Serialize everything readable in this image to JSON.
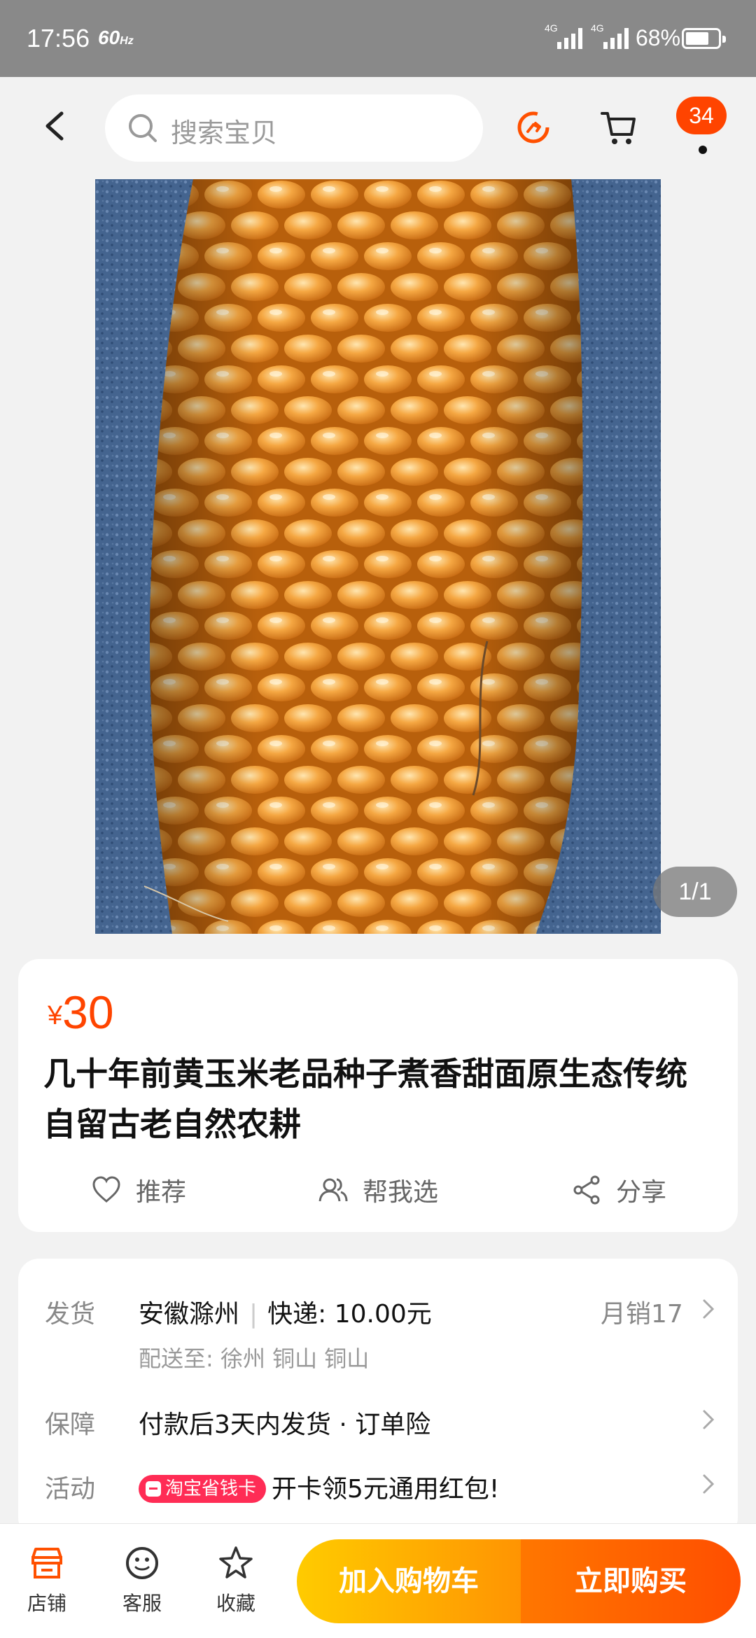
{
  "status_bar": {
    "time": "17:56",
    "refresh_rate": "60",
    "refresh_unit": "Hz",
    "network_1": "4G",
    "network_2": "4G",
    "battery": "68%"
  },
  "nav": {
    "search_placeholder": "搜索宝贝",
    "message_badge": "34"
  },
  "gallery": {
    "counter": "1/1"
  },
  "product": {
    "currency": "¥",
    "price": "30",
    "title": "几十年前黄玉米老品种子煮香甜面原生态传统自留古老自然农耕",
    "actions": [
      {
        "label": "推荐",
        "icon": "heart-icon"
      },
      {
        "label": "帮我选",
        "icon": "group-icon"
      },
      {
        "label": "分享",
        "icon": "share-icon"
      }
    ]
  },
  "details": {
    "shipping_label": "发货",
    "origin": "安徽滁州",
    "express": "快递: 10.00元",
    "monthly_sales": "月销17",
    "delivery_to": "配送至: 徐州 铜山 铜山",
    "guarantee_label": "保障",
    "guarantee_text": "付款后3天内发货 · 订单险",
    "promo_label": "活动",
    "promo_badge": "淘宝省钱卡",
    "promo_text": "开卡领5元通用红包!"
  },
  "bottom_bar": {
    "shop_label": "店铺",
    "service_label": "客服",
    "favorite_label": "收藏",
    "add_cart_label": "加入购物车",
    "buy_now_label": "立即购买"
  },
  "colors": {
    "accent": "#ff4400",
    "cart_button": "#ff9402",
    "buy_button": "#ff5000"
  }
}
